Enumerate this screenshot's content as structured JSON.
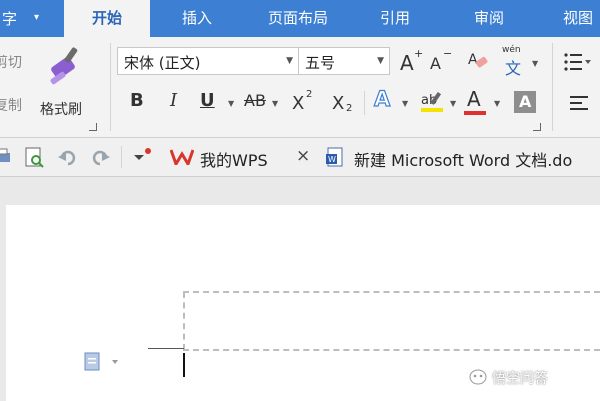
{
  "app_menu": {
    "label": "字",
    "arrow": "▾"
  },
  "tabs": [
    {
      "label": "开始",
      "active": true
    },
    {
      "label": "插入",
      "active": false
    },
    {
      "label": "页面布局",
      "active": false
    },
    {
      "label": "引用",
      "active": false
    },
    {
      "label": "审阅",
      "active": false
    },
    {
      "label": "视图",
      "active": false
    }
  ],
  "clipboard": {
    "cut_label": "剪切",
    "copy_label": "复制",
    "format_painter_label": "格式刷"
  },
  "font": {
    "family_value": "宋体 (正文)",
    "size_value": "五号",
    "bold": "B",
    "italic": "I",
    "underline": "U",
    "strikethrough": "AB",
    "superscript": "X",
    "superscript_mark": "2",
    "subscript": "X",
    "subscript_mark": "2",
    "grow": "A",
    "grow_mark": "+",
    "shrink": "A",
    "shrink_mark": "−",
    "phonetic_top": "wén",
    "phonetic_char": "文",
    "text_effect": "A",
    "font_color": "A",
    "char_shading": "A",
    "highlight_color": "#f2e400",
    "font_color_bar": "#e03030"
  },
  "doc_tabs": [
    {
      "label": "我的WPS",
      "close": "×"
    },
    {
      "label": "新建 Microsoft Word 文档.do"
    }
  ],
  "watermark": "悟空问答",
  "colors": {
    "accent": "#3c7fd3",
    "wps_red": "#d9362b",
    "active_tab_text": "#2b65b8"
  }
}
